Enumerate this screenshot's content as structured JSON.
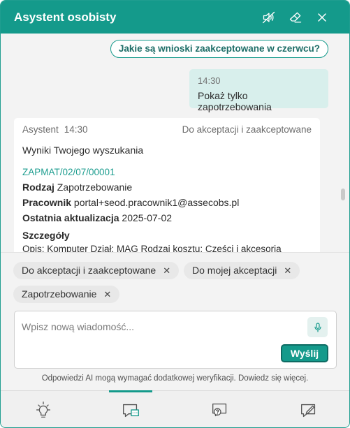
{
  "colors": {
    "accent": "#149a8b",
    "accent_dark": "#0e6b63",
    "user_bubble": "#d8efec",
    "link": "#1f9e90"
  },
  "header": {
    "title": "Asystent osobisty",
    "icons": [
      "speaker-muted-icon",
      "eraser-icon",
      "close-icon"
    ]
  },
  "chat": {
    "suggestion": "Jakie są wnioski zaakceptowane w czerwcu?",
    "user_message": {
      "time": "14:30",
      "text": "Pokaż tylko zapotrzebowania"
    },
    "bot_message": {
      "author": "Asystent",
      "time": "14:30",
      "filter_label": "Do akceptacji i zaakceptowane",
      "intro": "Wyniki Twojego wyszukania",
      "reference": "ZAPMAT/02/07/00001",
      "fields": [
        {
          "label": "Rodzaj",
          "value": "Zapotrzebowanie"
        },
        {
          "label": "Pracownik",
          "value": "portal+seod.pracownik1@assecobs.pl"
        },
        {
          "label": "Ostatnia aktualizacja",
          "value": "2025-07-02"
        }
      ],
      "details_title": "Szczegóły",
      "details_text": "Opis: Komputer Dział: MAG Rodzaj kosztu: Części i akcesoria"
    }
  },
  "filters": [
    {
      "label": "Do akceptacji i zaakceptowane"
    },
    {
      "label": "Do mojej akceptacji"
    },
    {
      "label": "Zapotrzebowanie"
    }
  ],
  "input": {
    "placeholder": "Wpisz nową wiadomość...",
    "value": "",
    "send_label": "Wyślij"
  },
  "disclaimer": "Odpowiedzi AI mogą wymagać dodatkowej weryfikacji. Dowiedz się więcej.",
  "footer": {
    "tabs": [
      {
        "icon": "lightbulb-icon",
        "active": false
      },
      {
        "icon": "chat-icon",
        "active": true
      },
      {
        "icon": "help-chat-icon",
        "active": false
      },
      {
        "icon": "edit-note-icon",
        "active": false
      }
    ]
  }
}
